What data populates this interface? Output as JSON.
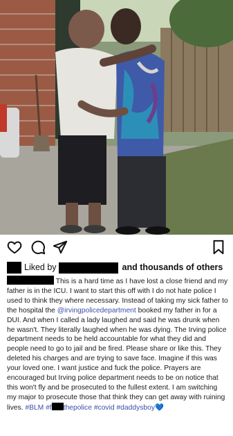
{
  "post": {
    "photo_description": "",
    "actions": {
      "like_icon": "heart-outline-icon",
      "comment_icon": "comment-bubble-icon",
      "share_icon": "paper-plane-icon",
      "save_icon": "bookmark-outline-icon"
    },
    "likes": {
      "prefix": "Liked by",
      "suffix": "and thousands of others"
    },
    "caption": {
      "line1_rest": "This is a hard time as I have lost a close friend",
      "body1": "and my father is in the ICU. I want to start this off with I do not hate police I used to think they where necessary. Instead of taking my sick father to the hospital the",
      "mention": "@irvingpolicedepartment",
      "body2": "booked my father in for a DUI. And when I called a lady laughed and said he was drunk when he wasn't. They literally laughed when he was dying. The Irving police department needs to be held accountable for what they did and people need to go to jail and be fired. Please share or like this. They deleted his charges and are trying to save face. Imagine if this was your loved one. I want justice and fuck the police. Prayers are encouraged but Irving police department needs to be on notice that this won't fly and be prosecuted to the fullest extent. I am switching my major to prosecute those that think they can get away with ruining lives.",
      "hashtag_blm": "#BLM",
      "hashtag_ftp_prefix": "#f",
      "hashtag_ftp_suffix": "thepolice",
      "hashtag_covid": "#covid",
      "hashtag_daddysboy": "#daddysboy",
      "emoji": "💙"
    }
  }
}
